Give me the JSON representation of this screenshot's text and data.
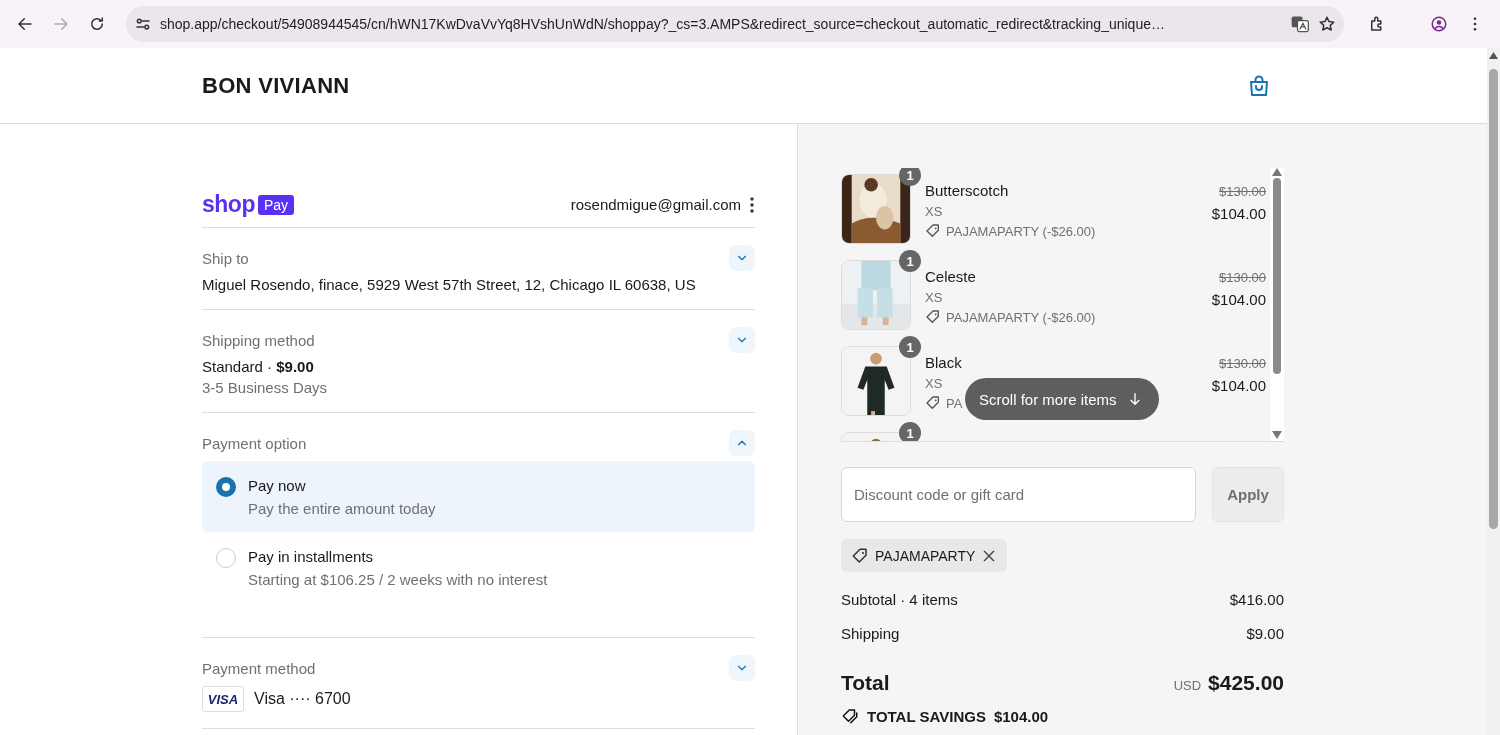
{
  "browser": {
    "url": "shop.app/checkout/54908944545/cn/hWN17KwDvaVvYq8HVshUnWdN/shoppay?_cs=3.AMPS&redirect_source=checkout_automatic_redirect&tracking_unique…",
    "back_disabled": false,
    "forward_disabled": true
  },
  "store": {
    "name": "BON VIVIANN"
  },
  "account": {
    "logo_word": "shop",
    "logo_badge": "Pay",
    "email": "rosendmigue@gmail.com"
  },
  "sections": [
    {
      "kind": "ship",
      "label": "Ship to",
      "expanded": false,
      "lines": [
        {
          "text": "Miguel Rosendo, finace, 5929 West 57th Street, 12, Chicago IL 60638, US",
          "kind": "main"
        }
      ]
    },
    {
      "kind": "shipping",
      "label": "Shipping method",
      "expanded": false,
      "lines": [
        {
          "text": "Standard · **$9.00**",
          "kind": "main"
        },
        {
          "text": "3-5 Business Days",
          "kind": "sub"
        }
      ]
    },
    {
      "kind": "options",
      "label": "Payment option",
      "expanded": true,
      "options": [
        {
          "title": "Pay now",
          "subtitle": "Pay the entire amount today",
          "selected": true
        },
        {
          "title": "Pay in installments",
          "subtitle": "Starting at $106.25 / 2 weeks with no interest",
          "selected": false
        }
      ]
    },
    {
      "kind": "card",
      "label": "Payment method",
      "expanded": false,
      "card_brand": "VISA",
      "card_text": "Visa ···· 6700"
    }
  ],
  "items": [
    {
      "quantity": "1",
      "name": "Butterscotch",
      "variant": "XS",
      "discount": "PAJAMAPARTY (-$26.00)",
      "compare_price": "$130.00",
      "price": "$104.00",
      "kind": "full"
    },
    {
      "quantity": "1",
      "name": "Celeste",
      "variant": "XS",
      "discount": "PAJAMAPARTY (-$26.00)",
      "compare_price": "$130.00",
      "price": "$104.00",
      "kind": "full"
    },
    {
      "quantity": "1",
      "name": "Black",
      "variant": "XS",
      "discount": "PA",
      "compare_price": "$130.00",
      "price": "$104.00",
      "kind": "full"
    },
    {
      "quantity": "1",
      "kind": "partial"
    }
  ],
  "scroll_hint": "Scroll for more items",
  "discount": {
    "placeholder": "Discount code or gift card",
    "button": "Apply",
    "applied_code": "PAJAMAPARTY"
  },
  "summary": [
    {
      "label": "Subtotal · 4 items",
      "value": "$416.00"
    },
    {
      "label": "Shipping",
      "value": "$9.00"
    }
  ],
  "total": {
    "label": "Total",
    "currency": "USD",
    "value": "$425.00"
  },
  "savings": {
    "label": "TOTAL SAVINGS",
    "value": "$104.00"
  }
}
